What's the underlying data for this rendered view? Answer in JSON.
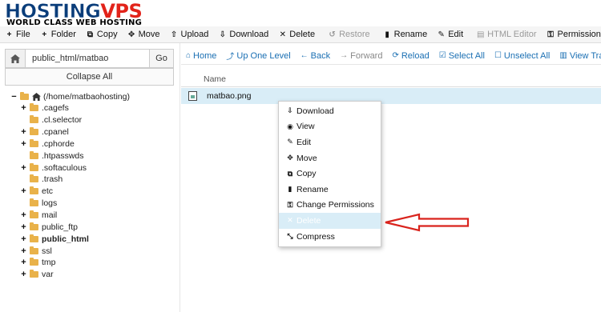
{
  "brand": {
    "part1": "HOSTING",
    "part2": "VPS",
    "tagline": "WORLD CLASS WEB HOSTING"
  },
  "toolbar": [
    {
      "icon": "+",
      "label": "File",
      "disabled": false,
      "name": "new-file-button"
    },
    {
      "icon": "+",
      "label": "Folder",
      "disabled": false,
      "name": "new-folder-button"
    },
    {
      "icon": "⧉",
      "label": "Copy",
      "disabled": false,
      "name": "copy-button"
    },
    {
      "icon": "✥",
      "label": "Move",
      "disabled": false,
      "name": "move-button"
    },
    {
      "icon": "⇧",
      "label": "Upload",
      "disabled": false,
      "name": "upload-button"
    },
    {
      "icon": "⇩",
      "label": "Download",
      "disabled": false,
      "name": "download-button"
    },
    {
      "icon": "✕",
      "label": "Delete",
      "disabled": false,
      "name": "delete-button"
    },
    {
      "icon": "↺",
      "label": "Restore",
      "disabled": true,
      "name": "restore-button"
    },
    {
      "icon": "▮",
      "label": "Rename",
      "disabled": false,
      "name": "rename-button"
    },
    {
      "icon": "✎",
      "label": "Edit",
      "disabled": false,
      "name": "edit-button"
    },
    {
      "icon": "▤",
      "label": "HTML Editor",
      "disabled": true,
      "name": "html-editor-button"
    },
    {
      "icon": "⚿",
      "label": "Permissions",
      "disabled": false,
      "name": "permissions-button"
    }
  ],
  "left": {
    "path_value": "public_html/matbao",
    "go_label": "Go",
    "collapse_label": "Collapse All",
    "tree": [
      {
        "label": "(/home/matbaohosting)",
        "expander": "−",
        "home": true,
        "indent": 0,
        "bold": false
      },
      {
        "label": ".cagefs",
        "expander": "+",
        "indent": 1,
        "bold": false
      },
      {
        "label": ".cl.selector",
        "expander": "",
        "indent": 1,
        "bold": false
      },
      {
        "label": ".cpanel",
        "expander": "+",
        "indent": 1,
        "bold": false
      },
      {
        "label": ".cphorde",
        "expander": "+",
        "indent": 1,
        "bold": false
      },
      {
        "label": ".htpasswds",
        "expander": "",
        "indent": 1,
        "bold": false
      },
      {
        "label": ".softaculous",
        "expander": "+",
        "indent": 1,
        "bold": false
      },
      {
        "label": ".trash",
        "expander": "",
        "indent": 1,
        "bold": false
      },
      {
        "label": "etc",
        "expander": "+",
        "indent": 1,
        "bold": false
      },
      {
        "label": "logs",
        "expander": "",
        "indent": 1,
        "bold": false
      },
      {
        "label": "mail",
        "expander": "+",
        "indent": 1,
        "bold": false
      },
      {
        "label": "public_ftp",
        "expander": "+",
        "indent": 1,
        "bold": false
      },
      {
        "label": "public_html",
        "expander": "+",
        "indent": 1,
        "bold": true
      },
      {
        "label": "ssl",
        "expander": "+",
        "indent": 1,
        "bold": false
      },
      {
        "label": "tmp",
        "expander": "+",
        "indent": 1,
        "bold": false
      },
      {
        "label": "var",
        "expander": "+",
        "indent": 1,
        "bold": false
      }
    ]
  },
  "nav": [
    {
      "icon": "⌂",
      "label": "Home",
      "disabled": false,
      "name": "home-nav-button"
    },
    {
      "icon": "⤴",
      "label": "Up One Level",
      "disabled": false,
      "name": "up-one-level-button"
    },
    {
      "icon": "←",
      "label": "Back",
      "disabled": false,
      "name": "back-button"
    },
    {
      "icon": "→",
      "label": "Forward",
      "disabled": true,
      "name": "forward-button"
    },
    {
      "icon": "⟳",
      "label": "Reload",
      "disabled": false,
      "name": "reload-button"
    },
    {
      "icon": "☑",
      "label": "Select All",
      "disabled": false,
      "name": "select-all-button"
    },
    {
      "icon": "☐",
      "label": "Unselect All",
      "disabled": false,
      "name": "unselect-all-button"
    },
    {
      "icon": "▥",
      "label": "View Tras",
      "disabled": false,
      "name": "view-trash-button"
    }
  ],
  "table": {
    "col_name": "Name"
  },
  "file": {
    "name": "matbao.png"
  },
  "context_menu": [
    {
      "icon": "⇩",
      "label": "Download",
      "name": "ctx-download"
    },
    {
      "icon": "◉",
      "label": "View",
      "name": "ctx-view"
    },
    {
      "icon": "✎",
      "label": "Edit",
      "name": "ctx-edit"
    },
    {
      "icon": "✥",
      "label": "Move",
      "name": "ctx-move"
    },
    {
      "icon": "⧉",
      "label": "Copy",
      "name": "ctx-copy"
    },
    {
      "icon": "▮",
      "label": "Rename",
      "name": "ctx-rename"
    },
    {
      "icon": "⚿",
      "label": "Change Permissions",
      "name": "ctx-change-permissions"
    },
    {
      "icon": "✕",
      "label": "Delete",
      "name": "ctx-delete",
      "highlighted": true
    },
    {
      "icon": "⤡",
      "label": "Compress",
      "name": "ctx-compress"
    }
  ],
  "colors": {
    "accent": "#1a6fb3",
    "highlight": "#d9edf7",
    "annotation_arrow": "#d9231c",
    "folder": "#e9b24a"
  }
}
